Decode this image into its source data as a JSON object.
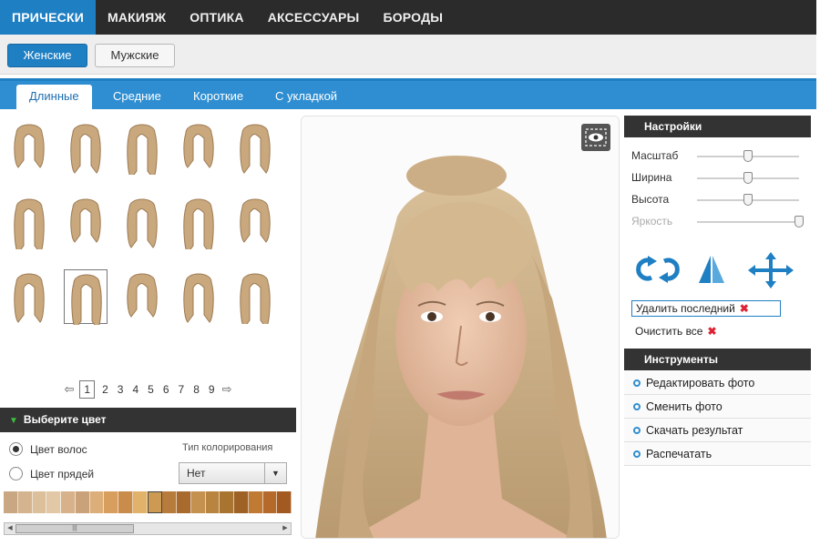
{
  "topnav": {
    "tabs": [
      {
        "label": "ПРИЧЕСКИ",
        "active": true
      },
      {
        "label": "МАКИЯЖ",
        "active": false
      },
      {
        "label": "ОПТИКА",
        "active": false
      },
      {
        "label": "АКСЕССУАРЫ",
        "active": false
      },
      {
        "label": "БОРОДЫ",
        "active": false
      }
    ]
  },
  "gender": {
    "female": "Женские",
    "male": "Мужские"
  },
  "length_tabs": [
    {
      "label": "Длинные",
      "active": true
    },
    {
      "label": "Средние",
      "active": false
    },
    {
      "label": "Короткие",
      "active": false
    },
    {
      "label": "С укладкой",
      "active": false
    }
  ],
  "hairstyles": {
    "count": 15,
    "selected_index": 11
  },
  "pager": {
    "pages": [
      "1",
      "2",
      "3",
      "4",
      "5",
      "6",
      "7",
      "8",
      "9"
    ],
    "current": "1",
    "prev_icon": "arrow-left-icon",
    "next_icon": "arrow-right-icon"
  },
  "color_panel": {
    "header": "Выберите цвет",
    "radio_hair": "Цвет волос",
    "radio_strands": "Цвет прядей",
    "selected_radio": "hair",
    "type_label": "Тип колорирования",
    "type_value": "Нет",
    "swatches": [
      "#c9a783",
      "#d4b48f",
      "#dcc09c",
      "#e2c8a6",
      "#d7b18a",
      "#caa27a",
      "#dcae7a",
      "#d89e5e",
      "#c98c4a",
      "#e0b26a",
      "#cc9a52",
      "#b77b3c",
      "#a96a2e",
      "#c4914f",
      "#b9843f",
      "#a8742f",
      "#9e6226",
      "#c07a33",
      "#b5692a",
      "#a25a22"
    ],
    "selected_swatch": 10
  },
  "settings": {
    "header": "Настройки",
    "sliders": [
      {
        "label": "Масштаб",
        "value": 0.5,
        "enabled": true
      },
      {
        "label": "Ширина",
        "value": 0.5,
        "enabled": true
      },
      {
        "label": "Высота",
        "value": 0.5,
        "enabled": true
      },
      {
        "label": "Яркость",
        "value": 1.0,
        "enabled": false
      }
    ],
    "delete_last": "Удалить последний",
    "clear_all": "Очистить все"
  },
  "tools": {
    "header": "Инструменты",
    "items": [
      "Редактировать фото",
      "Сменить фото",
      "Скачать результат",
      "Распечатать"
    ]
  },
  "colors": {
    "accent": "#1f7fc3",
    "nav": "#2b2b2b",
    "hair": "#c8a679"
  }
}
